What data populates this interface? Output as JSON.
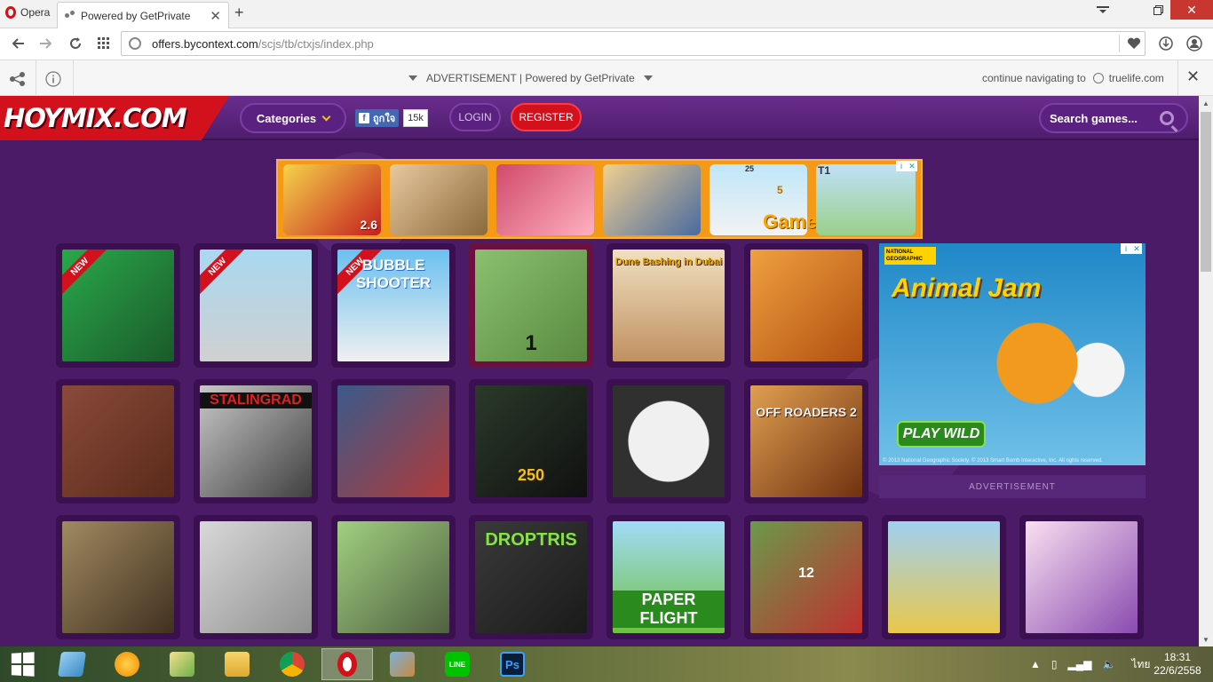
{
  "browser": {
    "menu_label": "Opera",
    "tab_title": "Powered by GetPrivate",
    "tab_close": "✕",
    "new_tab": "+",
    "url_domain": "offers.bycontext.com",
    "url_path": "/scjs/tb/ctxjs/index.php"
  },
  "adbar": {
    "center_text": "ADVERTISEMENT | Powered by GetPrivate",
    "continue_text": "continue navigating to",
    "continue_site": "truelife.com",
    "close": "✕"
  },
  "site": {
    "logo": "HOYMIX.COM",
    "categories_label": "Categories",
    "fb_like": "ถูกใจ",
    "fb_count": "15k",
    "login_label": "LOGIN",
    "register_label": "REGISTER",
    "search_placeholder": "Search games...",
    "banner_texts": [
      "2.6",
      "25",
      "5",
      "Game",
      "T1"
    ],
    "side_ad": {
      "brand": "NATIONAL GEOGRAPHIC",
      "title": "Animal Jam",
      "cta": "PLAY WILD",
      "copyright": "© 2013 National Geographic Society. © 2013 Smart Bomb Interactive, Inc. All rights reserved."
    },
    "ad_label": "ADVERTISEMENT",
    "new_tag": "NEW",
    "games": [
      {
        "text": "",
        "new": true
      },
      {
        "text": "",
        "new": true
      },
      {
        "text": "BUBBLE SHOOTER",
        "new": true
      },
      {
        "text": "1",
        "new": false
      },
      {
        "text": "Dune Bashing in Dubai",
        "new": false
      },
      {
        "text": "",
        "new": false
      },
      {
        "text": "",
        "new": false
      },
      {
        "text": "STALINGRAD",
        "new": false
      },
      {
        "text": "",
        "new": false
      },
      {
        "text": "250",
        "new": false
      },
      {
        "text": "",
        "new": false
      },
      {
        "text": "OFF ROADERS 2",
        "new": false
      },
      {
        "text": "",
        "new": false
      },
      {
        "text": "",
        "new": false
      },
      {
        "text": "",
        "new": false
      },
      {
        "text": "DROPTRIS",
        "new": false
      },
      {
        "text": "PAPER FLIGHT",
        "new": false
      },
      {
        "text": "12",
        "new": false
      },
      {
        "text": "",
        "new": false
      },
      {
        "text": "",
        "new": false
      }
    ]
  },
  "taskbar": {
    "language": "ไทย",
    "time": "18:31",
    "date": "22/6/2558"
  },
  "colors": {
    "site_bg": "#4b1b68",
    "logo_red": "#d2111d",
    "banner_orange": "#f49a16"
  }
}
